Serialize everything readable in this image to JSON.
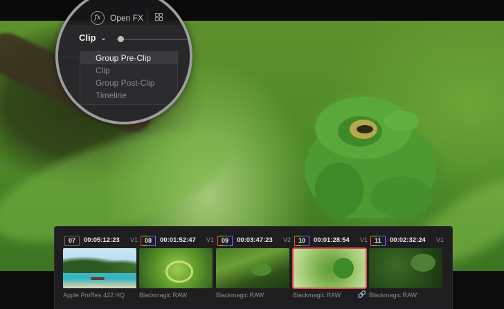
{
  "toolbar": {
    "fx_icon_text": "fx",
    "open_fx_label": "Open FX"
  },
  "clip_selector": {
    "label": "Clip",
    "menu_items": [
      "Group Pre-Clip",
      "Clip",
      "Group Post-Clip",
      "Timeline"
    ],
    "selected_index": 0
  },
  "clips": [
    {
      "number": "07",
      "timecode": "00:05:12:23",
      "track": "V1",
      "codec": "Apple ProRes 422 HQ",
      "selected": false,
      "linked": false,
      "rainbow_badge": false
    },
    {
      "number": "08",
      "timecode": "00:01:52:47",
      "track": "V1",
      "codec": "Blackmagic RAW",
      "selected": false,
      "linked": false,
      "rainbow_badge": true
    },
    {
      "number": "09",
      "timecode": "00:03:47:23",
      "track": "V2",
      "codec": "Blackmagic RAW",
      "selected": false,
      "linked": false,
      "rainbow_badge": true
    },
    {
      "number": "10",
      "timecode": "00:01:28:54",
      "track": "V1",
      "codec": "Blackmagic RAW",
      "selected": true,
      "linked": true,
      "rainbow_badge": true
    },
    {
      "number": "11",
      "timecode": "00:02:32:24",
      "track": "V1",
      "codec": "Blackmagic RAW",
      "selected": false,
      "linked": false,
      "rainbow_badge": true
    }
  ],
  "colors": {
    "selection_outline": "#e0474c",
    "link_icon": "#d8c24a",
    "panel_bg": "#1e1e20"
  }
}
